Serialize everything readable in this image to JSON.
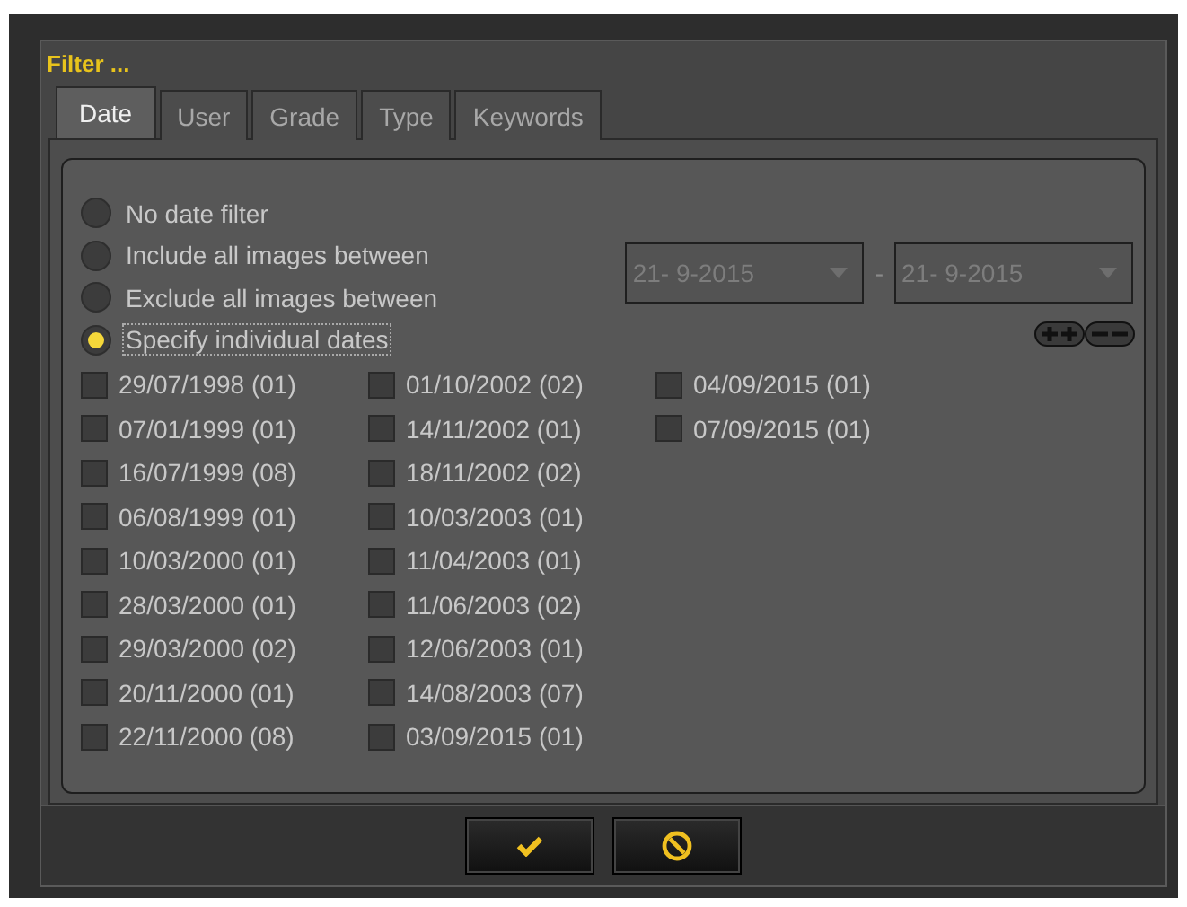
{
  "window": {
    "title": "Filter ..."
  },
  "tabs": [
    {
      "label": "Date",
      "selected": true
    },
    {
      "label": "User",
      "selected": false
    },
    {
      "label": "Grade",
      "selected": false
    },
    {
      "label": "Type",
      "selected": false
    },
    {
      "label": "Keywords",
      "selected": false
    }
  ],
  "date_modes": [
    {
      "label": "No date filter",
      "selected": false
    },
    {
      "label": "Include all images between",
      "selected": false
    },
    {
      "label": "Exclude all images between",
      "selected": false
    },
    {
      "label": "Specify individual dates",
      "selected": true
    }
  ],
  "range": {
    "from": "21- 9-2015",
    "separator": "-",
    "to": "21- 9-2015",
    "disabled": true
  },
  "date_columns": [
    [
      {
        "label": "29/07/1998 (01)",
        "checked": false
      },
      {
        "label": "07/01/1999 (01)",
        "checked": false
      },
      {
        "label": "16/07/1999 (08)",
        "checked": false
      },
      {
        "label": "06/08/1999 (01)",
        "checked": false
      },
      {
        "label": "10/03/2000 (01)",
        "checked": false
      },
      {
        "label": "28/03/2000 (01)",
        "checked": false
      },
      {
        "label": "29/03/2000 (02)",
        "checked": false
      },
      {
        "label": "20/11/2000 (01)",
        "checked": false
      },
      {
        "label": "22/11/2000 (08)",
        "checked": false
      }
    ],
    [
      {
        "label": "01/10/2002 (02)",
        "checked": false
      },
      {
        "label": "14/11/2002 (01)",
        "checked": false
      },
      {
        "label": "18/11/2002 (02)",
        "checked": false
      },
      {
        "label": "10/03/2003 (01)",
        "checked": false
      },
      {
        "label": "11/04/2003 (01)",
        "checked": false
      },
      {
        "label": "11/06/2003 (02)",
        "checked": false
      },
      {
        "label": "12/06/2003 (01)",
        "checked": false
      },
      {
        "label": "14/08/2003 (07)",
        "checked": false
      },
      {
        "label": "03/09/2015 (01)",
        "checked": false
      }
    ],
    [
      {
        "label": "04/09/2015 (01)",
        "checked": false
      },
      {
        "label": "07/09/2015 (01)",
        "checked": false
      }
    ]
  ]
}
